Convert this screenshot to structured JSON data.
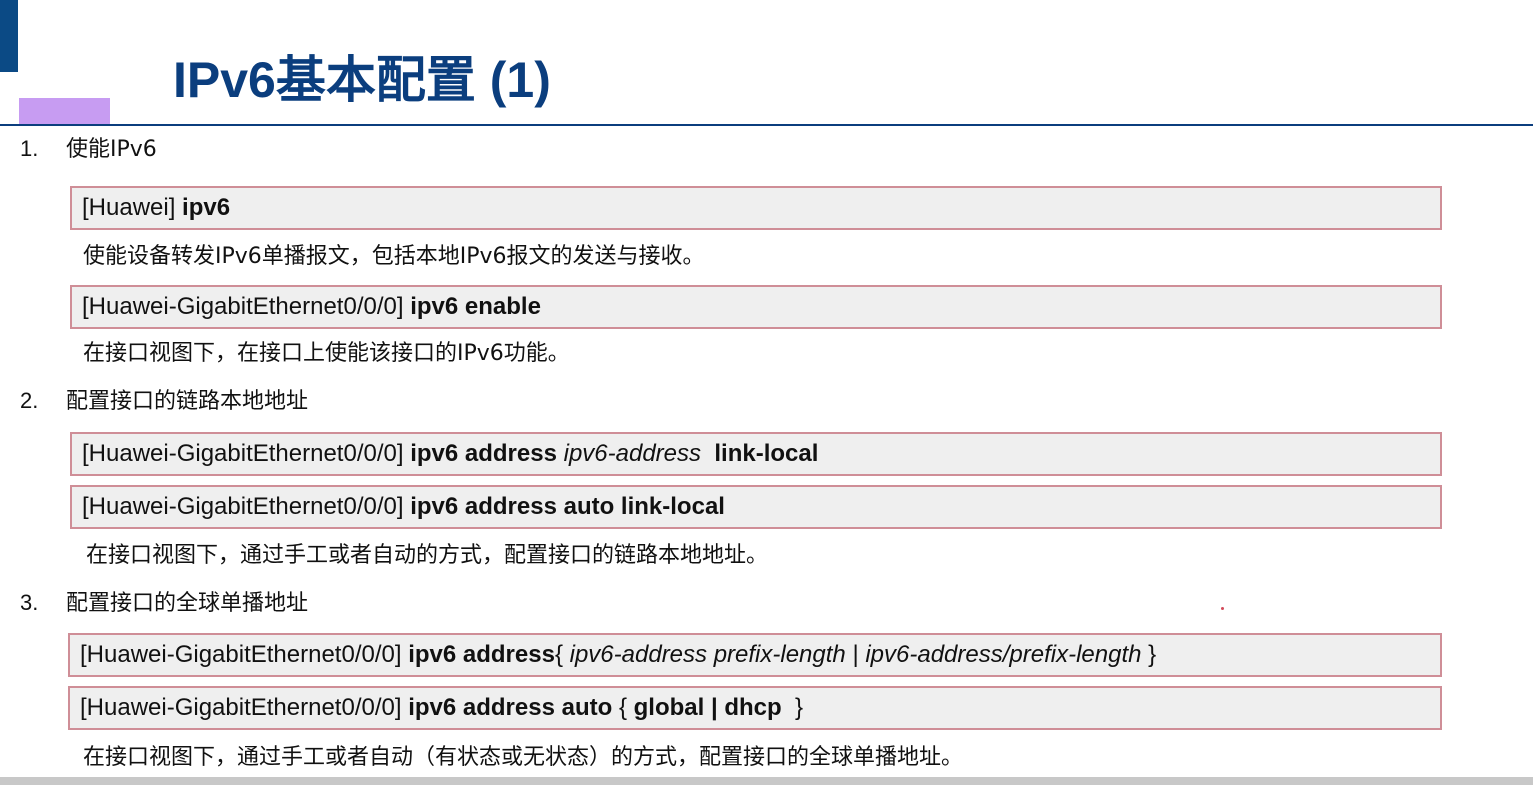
{
  "title": "IPv6基本配置 (1)",
  "colors": {
    "title": "#0b3e7e",
    "accent_bar": "#0b4a85",
    "accent_block": "#c79cf2",
    "cmd_border": "#cf8e97",
    "cmd_bg": "#efefef"
  },
  "steps": [
    {
      "num": "1.",
      "heading": "使能IPv6",
      "commands": [
        {
          "prompt": "[Huawei]",
          "keyword": "ipv6"
        },
        {
          "prompt": "[Huawei-GigabitEthernet0/0/0]",
          "keyword": "ipv6 enable"
        }
      ],
      "descriptions": [
        "使能设备转发IPv6单播报文，包括本地IPv6报文的发送与接收。",
        "在接口视图下，在接口上使能该接口的IPv6功能。"
      ]
    },
    {
      "num": "2.",
      "heading": "配置接口的链路本地地址",
      "commands": [
        {
          "prompt": "[Huawei-GigabitEthernet0/0/0]",
          "keyword": "ipv6 address",
          "param": "ipv6-address",
          "keyword2": "link-local"
        },
        {
          "prompt": "[Huawei-GigabitEthernet0/0/0]",
          "keyword": "ipv6 address auto link-local"
        }
      ],
      "descriptions": [
        "在接口视图下，通过手工或者自动的方式，配置接口的链路本地地址。"
      ]
    },
    {
      "num": "3.",
      "heading": "配置接口的全球单播地址",
      "commands": [
        {
          "prompt": "[Huawei-GigabitEthernet0/0/0]",
          "keyword": "ipv6 address",
          "open": "{",
          "param": "ipv6-address prefix-length",
          "sep": "|",
          "param2": "ipv6-address/prefix-length",
          "close": "}"
        },
        {
          "prompt": "[Huawei-GigabitEthernet0/0/0]",
          "keyword": "ipv6 address auto",
          "open": "{",
          "opt1": "global",
          "sep": "|",
          "opt2": "dhcp",
          "close": "}"
        }
      ],
      "descriptions": [
        "在接口视图下，通过手工或者自动（有状态或无状态）的方式，配置接口的全球单播地址。"
      ]
    }
  ]
}
